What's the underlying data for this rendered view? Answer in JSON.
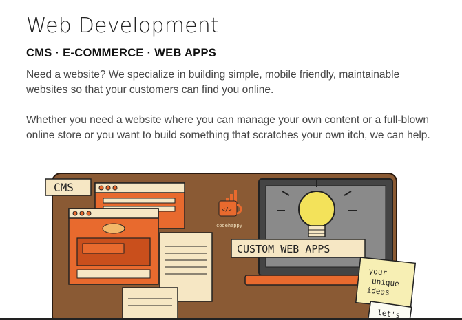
{
  "section": {
    "title": "Web Development",
    "subtitle": "CMS · E-COMMERCE · WEB APPS",
    "paragraphs": [
      "Need a website? We specialize in building simple, mobile friendly, maintainable websites so that your customers can find you online.",
      "Whether you need a website where you can manage your own content or a full-blown online store or you want to build something that scratches your own itch, we can help."
    ]
  },
  "illustration": {
    "cms_label": "CMS",
    "logo_text": "codehappy",
    "custom_label": "CUSTOM WEB APPS",
    "note_lines": [
      "your",
      "unique",
      "ideas"
    ],
    "note2_text": "let's",
    "colors": {
      "board": "#8a5a34",
      "orange": "#e86a2e",
      "paper": "#f6e7c4",
      "bulb": "#f3e25a",
      "screen": "#8a8a8a",
      "sticky": "#f7efb4"
    }
  }
}
